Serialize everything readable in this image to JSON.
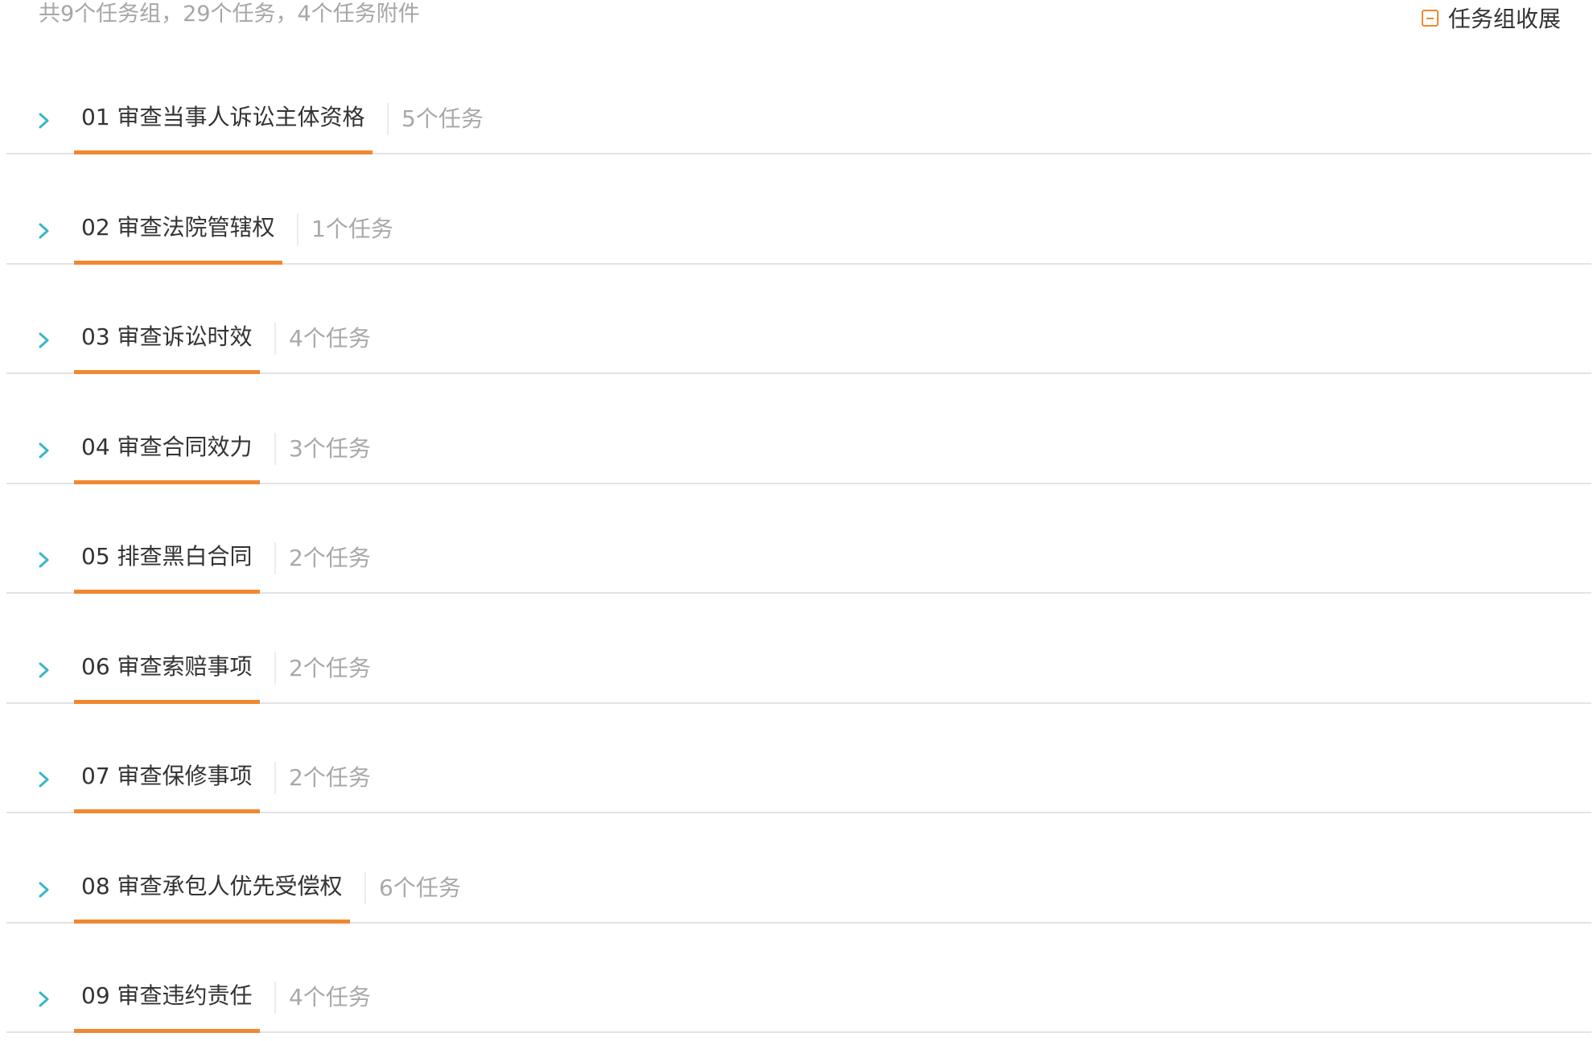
{
  "summary": "共9个任务组，29个任务，4个任务附件",
  "toggle_all": {
    "label": "任务组收展",
    "icon": "minus-square-icon",
    "icon_color": "#f0882f"
  },
  "colors": {
    "accent": "#f0882f",
    "chevron": "#39b6c9",
    "title": "#333333",
    "muted": "#a8a8a8",
    "line": "#e3e3e3"
  },
  "groups": [
    {
      "title": "01 审查当事人诉讼主体资格",
      "count": "5个任务"
    },
    {
      "title": "02 审查法院管辖权",
      "count": "1个任务"
    },
    {
      "title": "03 审查诉讼时效",
      "count": "4个任务"
    },
    {
      "title": "04 审查合同效力",
      "count": "3个任务"
    },
    {
      "title": "05 排查黑白合同",
      "count": "2个任务"
    },
    {
      "title": "06 审查索赔事项",
      "count": "2个任务"
    },
    {
      "title": "07 审查保修事项",
      "count": "2个任务"
    },
    {
      "title": "08 审查承包人优先受偿权",
      "count": "6个任务"
    },
    {
      "title": "09 审查违约责任",
      "count": "4个任务"
    }
  ]
}
